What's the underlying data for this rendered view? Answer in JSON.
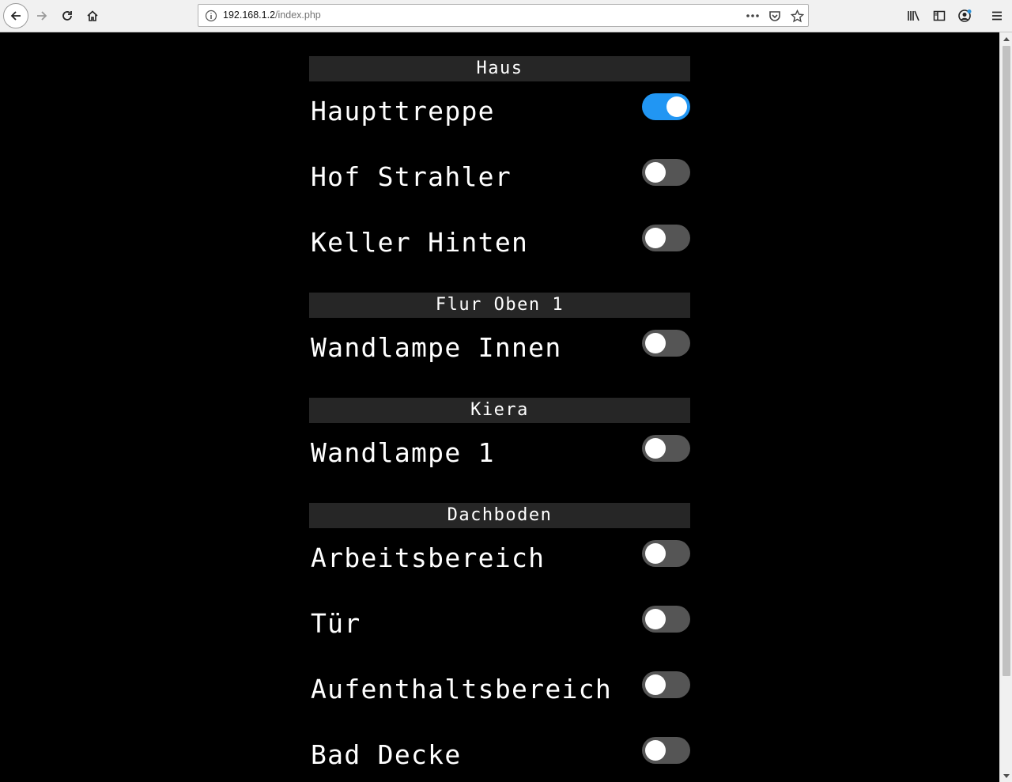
{
  "browser": {
    "url_host": "192.168.1.2",
    "url_path": "/index.php",
    "icons": [
      "back-icon",
      "forward-icon",
      "reload-icon",
      "home-icon",
      "info-icon",
      "more-icon",
      "pocket-icon",
      "bookmark-star-icon",
      "library-icon",
      "sidebar-icon",
      "account-icon",
      "menu-icon"
    ]
  },
  "sections": [
    {
      "title": "Haus",
      "items": [
        {
          "label": "Haupttreppe",
          "on": true
        },
        {
          "label": "Hof Strahler",
          "on": false
        },
        {
          "label": "Keller Hinten",
          "on": false
        }
      ]
    },
    {
      "title": "Flur Oben 1",
      "items": [
        {
          "label": "Wandlampe Innen",
          "on": false
        }
      ]
    },
    {
      "title": "Kiera",
      "items": [
        {
          "label": "Wandlampe 1",
          "on": false
        }
      ]
    },
    {
      "title": "Dachboden",
      "items": [
        {
          "label": "Arbeitsbereich",
          "on": false
        },
        {
          "label": "Tür",
          "on": false
        },
        {
          "label": "Aufenthaltsbereich",
          "on": false
        },
        {
          "label": "Bad Decke",
          "on": false
        }
      ]
    }
  ],
  "colors": {
    "toggle_on": "#2196f3",
    "toggle_off": "#555555",
    "header_bg": "#262626",
    "page_bg": "#000000"
  }
}
